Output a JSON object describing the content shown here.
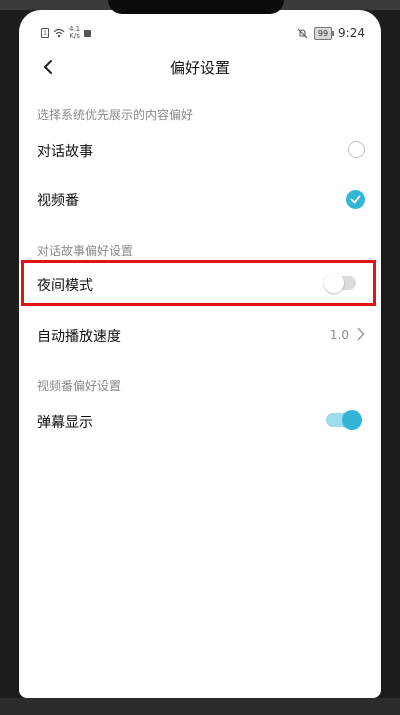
{
  "status_bar": {
    "net_speed_value": "4.1",
    "net_speed_unit": "K/s",
    "battery": "99",
    "time": "9:24"
  },
  "header": {
    "title": "偏好设置"
  },
  "sections": [
    {
      "label": "选择系统优先展示的内容偏好",
      "items": [
        {
          "label": "对话故事",
          "control": "radio",
          "selected": false
        },
        {
          "label": "视频番",
          "control": "radio",
          "selected": true
        }
      ]
    },
    {
      "label": "对话故事偏好设置",
      "items": [
        {
          "label": "夜间模式",
          "control": "toggle",
          "on": false
        },
        {
          "label": "自动播放速度",
          "control": "value",
          "value": "1.0"
        }
      ]
    },
    {
      "label": "视频番偏好设置",
      "items": [
        {
          "label": "弹幕显示",
          "control": "toggle",
          "on": true
        }
      ]
    }
  ],
  "colors": {
    "accent": "#33b5d6",
    "accent_track": "#9ddcec",
    "highlight": "#e01414",
    "section_label": "#8a8a8a"
  },
  "icons": {
    "back": "back-arrow-icon",
    "check": "check-icon",
    "chevron": "chevron-right-icon",
    "mute": "bell-off-icon"
  }
}
